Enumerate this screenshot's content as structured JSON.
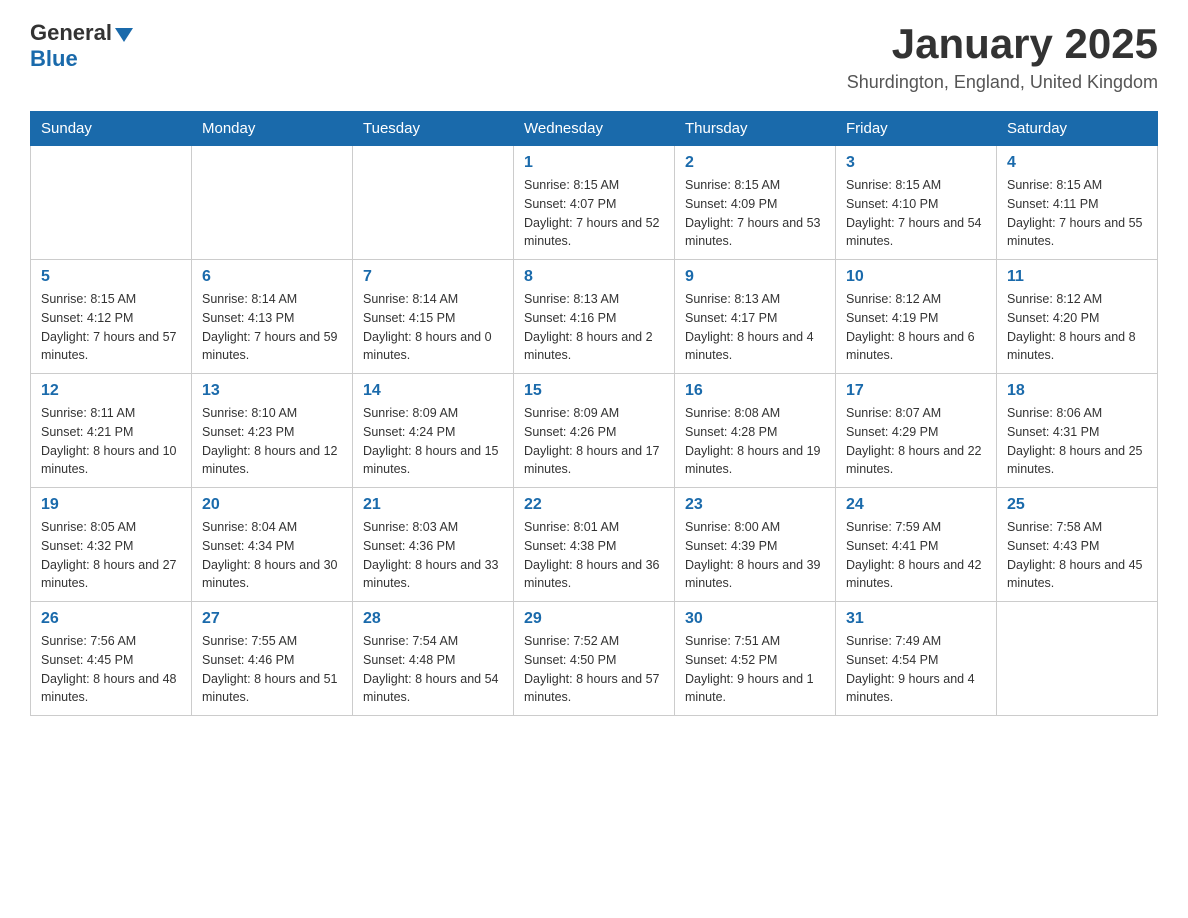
{
  "header": {
    "logo_general": "General",
    "logo_blue": "Blue",
    "title": "January 2025",
    "subtitle": "Shurdington, England, United Kingdom"
  },
  "columns": [
    "Sunday",
    "Monday",
    "Tuesday",
    "Wednesday",
    "Thursday",
    "Friday",
    "Saturday"
  ],
  "weeks": [
    [
      {
        "day": "",
        "info": ""
      },
      {
        "day": "",
        "info": ""
      },
      {
        "day": "",
        "info": ""
      },
      {
        "day": "1",
        "info": "Sunrise: 8:15 AM\nSunset: 4:07 PM\nDaylight: 7 hours\nand 52 minutes."
      },
      {
        "day": "2",
        "info": "Sunrise: 8:15 AM\nSunset: 4:09 PM\nDaylight: 7 hours\nand 53 minutes."
      },
      {
        "day": "3",
        "info": "Sunrise: 8:15 AM\nSunset: 4:10 PM\nDaylight: 7 hours\nand 54 minutes."
      },
      {
        "day": "4",
        "info": "Sunrise: 8:15 AM\nSunset: 4:11 PM\nDaylight: 7 hours\nand 55 minutes."
      }
    ],
    [
      {
        "day": "5",
        "info": "Sunrise: 8:15 AM\nSunset: 4:12 PM\nDaylight: 7 hours\nand 57 minutes."
      },
      {
        "day": "6",
        "info": "Sunrise: 8:14 AM\nSunset: 4:13 PM\nDaylight: 7 hours\nand 59 minutes."
      },
      {
        "day": "7",
        "info": "Sunrise: 8:14 AM\nSunset: 4:15 PM\nDaylight: 8 hours\nand 0 minutes."
      },
      {
        "day": "8",
        "info": "Sunrise: 8:13 AM\nSunset: 4:16 PM\nDaylight: 8 hours\nand 2 minutes."
      },
      {
        "day": "9",
        "info": "Sunrise: 8:13 AM\nSunset: 4:17 PM\nDaylight: 8 hours\nand 4 minutes."
      },
      {
        "day": "10",
        "info": "Sunrise: 8:12 AM\nSunset: 4:19 PM\nDaylight: 8 hours\nand 6 minutes."
      },
      {
        "day": "11",
        "info": "Sunrise: 8:12 AM\nSunset: 4:20 PM\nDaylight: 8 hours\nand 8 minutes."
      }
    ],
    [
      {
        "day": "12",
        "info": "Sunrise: 8:11 AM\nSunset: 4:21 PM\nDaylight: 8 hours\nand 10 minutes."
      },
      {
        "day": "13",
        "info": "Sunrise: 8:10 AM\nSunset: 4:23 PM\nDaylight: 8 hours\nand 12 minutes."
      },
      {
        "day": "14",
        "info": "Sunrise: 8:09 AM\nSunset: 4:24 PM\nDaylight: 8 hours\nand 15 minutes."
      },
      {
        "day": "15",
        "info": "Sunrise: 8:09 AM\nSunset: 4:26 PM\nDaylight: 8 hours\nand 17 minutes."
      },
      {
        "day": "16",
        "info": "Sunrise: 8:08 AM\nSunset: 4:28 PM\nDaylight: 8 hours\nand 19 minutes."
      },
      {
        "day": "17",
        "info": "Sunrise: 8:07 AM\nSunset: 4:29 PM\nDaylight: 8 hours\nand 22 minutes."
      },
      {
        "day": "18",
        "info": "Sunrise: 8:06 AM\nSunset: 4:31 PM\nDaylight: 8 hours\nand 25 minutes."
      }
    ],
    [
      {
        "day": "19",
        "info": "Sunrise: 8:05 AM\nSunset: 4:32 PM\nDaylight: 8 hours\nand 27 minutes."
      },
      {
        "day": "20",
        "info": "Sunrise: 8:04 AM\nSunset: 4:34 PM\nDaylight: 8 hours\nand 30 minutes."
      },
      {
        "day": "21",
        "info": "Sunrise: 8:03 AM\nSunset: 4:36 PM\nDaylight: 8 hours\nand 33 minutes."
      },
      {
        "day": "22",
        "info": "Sunrise: 8:01 AM\nSunset: 4:38 PM\nDaylight: 8 hours\nand 36 minutes."
      },
      {
        "day": "23",
        "info": "Sunrise: 8:00 AM\nSunset: 4:39 PM\nDaylight: 8 hours\nand 39 minutes."
      },
      {
        "day": "24",
        "info": "Sunrise: 7:59 AM\nSunset: 4:41 PM\nDaylight: 8 hours\nand 42 minutes."
      },
      {
        "day": "25",
        "info": "Sunrise: 7:58 AM\nSunset: 4:43 PM\nDaylight: 8 hours\nand 45 minutes."
      }
    ],
    [
      {
        "day": "26",
        "info": "Sunrise: 7:56 AM\nSunset: 4:45 PM\nDaylight: 8 hours\nand 48 minutes."
      },
      {
        "day": "27",
        "info": "Sunrise: 7:55 AM\nSunset: 4:46 PM\nDaylight: 8 hours\nand 51 minutes."
      },
      {
        "day": "28",
        "info": "Sunrise: 7:54 AM\nSunset: 4:48 PM\nDaylight: 8 hours\nand 54 minutes."
      },
      {
        "day": "29",
        "info": "Sunrise: 7:52 AM\nSunset: 4:50 PM\nDaylight: 8 hours\nand 57 minutes."
      },
      {
        "day": "30",
        "info": "Sunrise: 7:51 AM\nSunset: 4:52 PM\nDaylight: 9 hours\nand 1 minute."
      },
      {
        "day": "31",
        "info": "Sunrise: 7:49 AM\nSunset: 4:54 PM\nDaylight: 9 hours\nand 4 minutes."
      },
      {
        "day": "",
        "info": ""
      }
    ]
  ]
}
